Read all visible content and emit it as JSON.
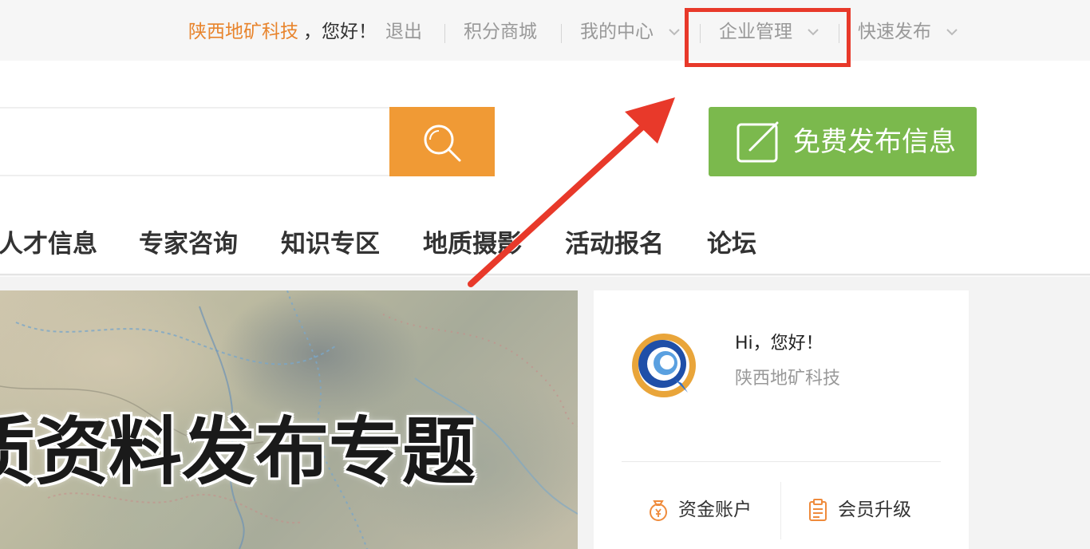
{
  "topbar": {
    "company": "陕西地矿科技",
    "greeting": "，您好！",
    "logout": "退出",
    "points_mall": "积分商城",
    "my_center": "我的中心",
    "enterprise_manage": "企业管理",
    "quick_publish": "快速发布"
  },
  "search": {
    "placeholder": "",
    "icon": "search-icon"
  },
  "publish_button": {
    "label": "免费发布信息",
    "icon": "edit-icon"
  },
  "nav": {
    "items": [
      "人才信息",
      "专家咨询",
      "知识专区",
      "地质摄影",
      "活动报名",
      "论坛"
    ]
  },
  "banner": {
    "title": "质资料发布专题"
  },
  "user_card": {
    "greeting": "Hi，您好！",
    "username": "陕西地矿科技",
    "links": [
      {
        "label": "资金账户",
        "icon": "money-bag-icon"
      },
      {
        "label": "会员升级",
        "icon": "clipboard-icon"
      }
    ]
  },
  "colors": {
    "brand_orange": "#e8842c",
    "search_button": "#f09a35",
    "publish_green": "#7bb94d",
    "annotation_red": "#e8392a"
  }
}
